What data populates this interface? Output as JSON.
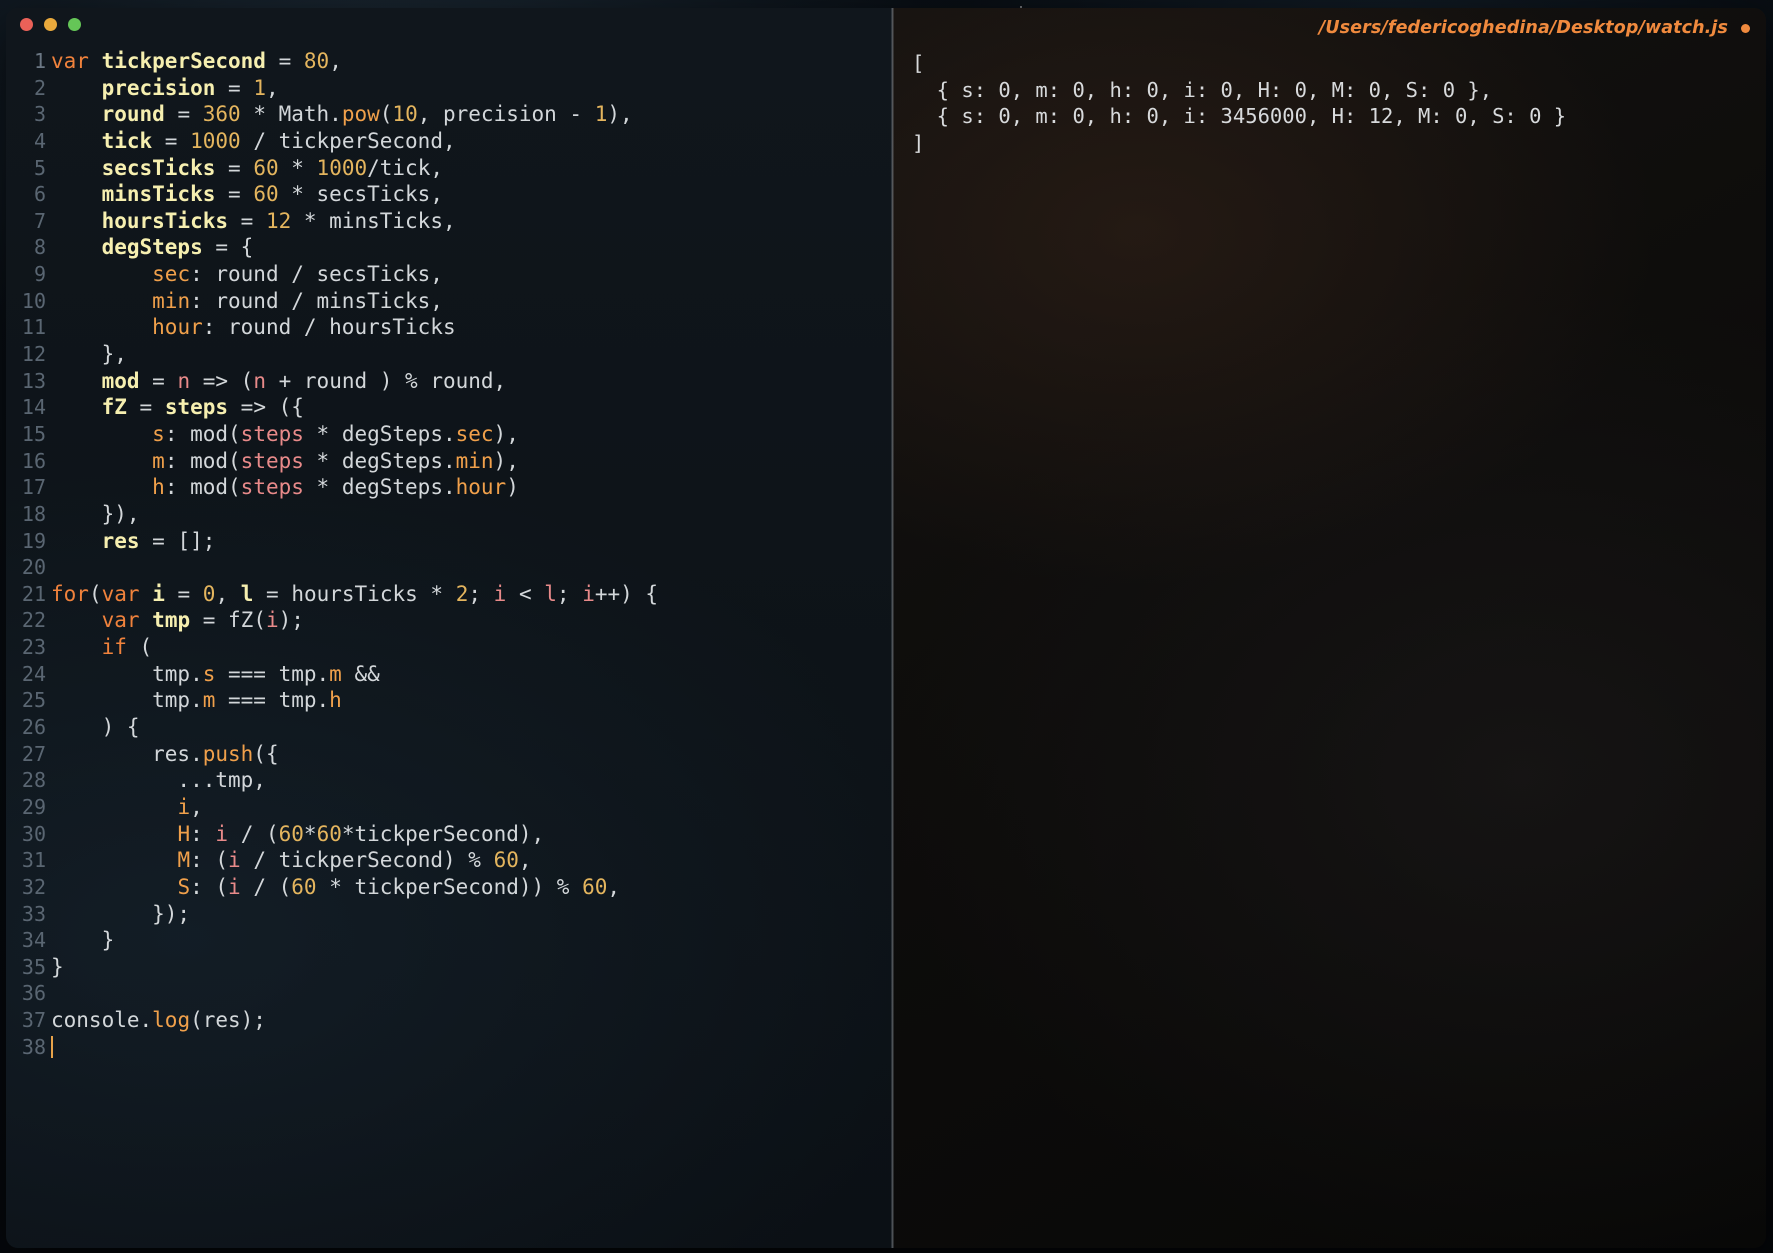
{
  "window": {
    "traffic_lights": [
      {
        "name": "close",
        "color": "#ea6158"
      },
      {
        "name": "minimize",
        "color": "#e9a93c"
      },
      {
        "name": "zoom",
        "color": "#65c657"
      }
    ],
    "title": "/Users/federicoghedina/Desktop/watch.js",
    "modified_indicator": "●",
    "accent_color": "#f08a3e"
  },
  "editor": {
    "language": "javascript",
    "cursor_line": 38,
    "lines": [
      {
        "n": "1",
        "tokens": [
          [
            "kw",
            "var"
          ],
          [
            "plain",
            " "
          ],
          [
            "def",
            "tickperSecond"
          ],
          [
            "plain",
            " = "
          ],
          [
            "num",
            "80"
          ],
          [
            "plain",
            ","
          ]
        ]
      },
      {
        "n": "2",
        "tokens": [
          [
            "plain",
            "    "
          ],
          [
            "def",
            "precision"
          ],
          [
            "plain",
            " = "
          ],
          [
            "num",
            "1"
          ],
          [
            "plain",
            ","
          ]
        ]
      },
      {
        "n": "3",
        "tokens": [
          [
            "plain",
            "    "
          ],
          [
            "def",
            "round"
          ],
          [
            "plain",
            " = "
          ],
          [
            "num",
            "360"
          ],
          [
            "plain",
            " * Math."
          ],
          [
            "fn",
            "pow"
          ],
          [
            "plain",
            "("
          ],
          [
            "num",
            "10"
          ],
          [
            "plain",
            ", precision - "
          ],
          [
            "num",
            "1"
          ],
          [
            "plain",
            "),"
          ]
        ]
      },
      {
        "n": "4",
        "tokens": [
          [
            "plain",
            "    "
          ],
          [
            "def",
            "tick"
          ],
          [
            "plain",
            " = "
          ],
          [
            "num",
            "1000"
          ],
          [
            "plain",
            " / tickperSecond,"
          ]
        ]
      },
      {
        "n": "5",
        "tokens": [
          [
            "plain",
            "    "
          ],
          [
            "def",
            "secsTicks"
          ],
          [
            "plain",
            " = "
          ],
          [
            "num",
            "60"
          ],
          [
            "plain",
            " * "
          ],
          [
            "num",
            "1000"
          ],
          [
            "plain",
            "/tick,"
          ]
        ]
      },
      {
        "n": "6",
        "tokens": [
          [
            "plain",
            "    "
          ],
          [
            "def",
            "minsTicks"
          ],
          [
            "plain",
            " = "
          ],
          [
            "num",
            "60"
          ],
          [
            "plain",
            " * secsTicks,"
          ]
        ]
      },
      {
        "n": "7",
        "tokens": [
          [
            "plain",
            "    "
          ],
          [
            "def",
            "hoursTicks"
          ],
          [
            "plain",
            " = "
          ],
          [
            "num",
            "12"
          ],
          [
            "plain",
            " * minsTicks,"
          ]
        ]
      },
      {
        "n": "8",
        "tokens": [
          [
            "plain",
            "    "
          ],
          [
            "def",
            "degSteps"
          ],
          [
            "plain",
            " = {"
          ]
        ]
      },
      {
        "n": "9",
        "tokens": [
          [
            "plain",
            "        "
          ],
          [
            "key",
            "sec"
          ],
          [
            "plain",
            ": round / secsTicks,"
          ]
        ]
      },
      {
        "n": "10",
        "tokens": [
          [
            "plain",
            "        "
          ],
          [
            "key",
            "min"
          ],
          [
            "plain",
            ": round / minsTicks,"
          ]
        ]
      },
      {
        "n": "11",
        "tokens": [
          [
            "plain",
            "        "
          ],
          [
            "key",
            "hour"
          ],
          [
            "plain",
            ": round / hoursTicks"
          ]
        ]
      },
      {
        "n": "12",
        "tokens": [
          [
            "plain",
            "    },"
          ]
        ]
      },
      {
        "n": "13",
        "tokens": [
          [
            "plain",
            "    "
          ],
          [
            "def",
            "mod"
          ],
          [
            "plain",
            " = "
          ],
          [
            "prm",
            "n"
          ],
          [
            "plain",
            " => ("
          ],
          [
            "prm",
            "n"
          ],
          [
            "plain",
            " + round ) % round,"
          ]
        ]
      },
      {
        "n": "14",
        "tokens": [
          [
            "plain",
            "    "
          ],
          [
            "def",
            "fZ"
          ],
          [
            "plain",
            " = "
          ],
          [
            "def",
            "steps"
          ],
          [
            "plain",
            " => ({"
          ]
        ]
      },
      {
        "n": "15",
        "tokens": [
          [
            "plain",
            "        "
          ],
          [
            "key",
            "s"
          ],
          [
            "plain",
            ": mod("
          ],
          [
            "prm",
            "steps"
          ],
          [
            "plain",
            " * degSteps."
          ],
          [
            "key",
            "sec"
          ],
          [
            "plain",
            "),"
          ]
        ]
      },
      {
        "n": "16",
        "tokens": [
          [
            "plain",
            "        "
          ],
          [
            "key",
            "m"
          ],
          [
            "plain",
            ": mod("
          ],
          [
            "prm",
            "steps"
          ],
          [
            "plain",
            " * degSteps."
          ],
          [
            "key",
            "min"
          ],
          [
            "plain",
            "),"
          ]
        ]
      },
      {
        "n": "17",
        "tokens": [
          [
            "plain",
            "        "
          ],
          [
            "key",
            "h"
          ],
          [
            "plain",
            ": mod("
          ],
          [
            "prm",
            "steps"
          ],
          [
            "plain",
            " * degSteps."
          ],
          [
            "key",
            "hour"
          ],
          [
            "plain",
            ")"
          ]
        ]
      },
      {
        "n": "18",
        "tokens": [
          [
            "plain",
            "    }),"
          ]
        ]
      },
      {
        "n": "19",
        "tokens": [
          [
            "plain",
            "    "
          ],
          [
            "def",
            "res"
          ],
          [
            "plain",
            " = [];"
          ]
        ]
      },
      {
        "n": "20",
        "tokens": []
      },
      {
        "n": "21",
        "tokens": [
          [
            "kw",
            "for"
          ],
          [
            "plain",
            "("
          ],
          [
            "kw",
            "var"
          ],
          [
            "plain",
            " "
          ],
          [
            "def",
            "i"
          ],
          [
            "plain",
            " = "
          ],
          [
            "num",
            "0"
          ],
          [
            "plain",
            ", "
          ],
          [
            "def",
            "l"
          ],
          [
            "plain",
            " = hoursTicks * "
          ],
          [
            "num",
            "2"
          ],
          [
            "plain",
            "; "
          ],
          [
            "prm",
            "i"
          ],
          [
            "plain",
            " < "
          ],
          [
            "prm",
            "l"
          ],
          [
            "plain",
            "; "
          ],
          [
            "prm",
            "i"
          ],
          [
            "plain",
            "++) {"
          ]
        ]
      },
      {
        "n": "22",
        "tokens": [
          [
            "plain",
            "    "
          ],
          [
            "kw",
            "var"
          ],
          [
            "plain",
            " "
          ],
          [
            "def",
            "tmp"
          ],
          [
            "plain",
            " = fZ("
          ],
          [
            "prm",
            "i"
          ],
          [
            "plain",
            ");"
          ]
        ]
      },
      {
        "n": "23",
        "tokens": [
          [
            "plain",
            "    "
          ],
          [
            "kw",
            "if"
          ],
          [
            "plain",
            " ("
          ]
        ]
      },
      {
        "n": "24",
        "tokens": [
          [
            "plain",
            "        tmp."
          ],
          [
            "key",
            "s"
          ],
          [
            "plain",
            " === tmp."
          ],
          [
            "key",
            "m"
          ],
          [
            "plain",
            " &&"
          ]
        ]
      },
      {
        "n": "25",
        "tokens": [
          [
            "plain",
            "        tmp."
          ],
          [
            "key",
            "m"
          ],
          [
            "plain",
            " === tmp."
          ],
          [
            "key",
            "h"
          ]
        ]
      },
      {
        "n": "26",
        "tokens": [
          [
            "plain",
            "    ) {"
          ]
        ]
      },
      {
        "n": "27",
        "tokens": [
          [
            "plain",
            "        res."
          ],
          [
            "fn",
            "push"
          ],
          [
            "plain",
            "({"
          ]
        ]
      },
      {
        "n": "28",
        "tokens": [
          [
            "plain",
            "          ...tmp,"
          ]
        ]
      },
      {
        "n": "29",
        "tokens": [
          [
            "plain",
            "          "
          ],
          [
            "key",
            "i"
          ],
          [
            "plain",
            ","
          ]
        ]
      },
      {
        "n": "30",
        "tokens": [
          [
            "plain",
            "          "
          ],
          [
            "key",
            "H"
          ],
          [
            "plain",
            ": "
          ],
          [
            "prm",
            "i"
          ],
          [
            "plain",
            " / ("
          ],
          [
            "num",
            "60"
          ],
          [
            "plain",
            "*"
          ],
          [
            "num",
            "60"
          ],
          [
            "plain",
            "*tickperSecond),"
          ]
        ]
      },
      {
        "n": "31",
        "tokens": [
          [
            "plain",
            "          "
          ],
          [
            "key",
            "M"
          ],
          [
            "plain",
            ": ("
          ],
          [
            "prm",
            "i"
          ],
          [
            "plain",
            " / tickperSecond) % "
          ],
          [
            "num",
            "60"
          ],
          [
            "plain",
            ","
          ]
        ]
      },
      {
        "n": "32",
        "tokens": [
          [
            "plain",
            "          "
          ],
          [
            "key",
            "S"
          ],
          [
            "plain",
            ": ("
          ],
          [
            "prm",
            "i"
          ],
          [
            "plain",
            " / ("
          ],
          [
            "num",
            "60"
          ],
          [
            "plain",
            " * tickperSecond)) % "
          ],
          [
            "num",
            "60"
          ],
          [
            "plain",
            ","
          ]
        ]
      },
      {
        "n": "33",
        "tokens": [
          [
            "plain",
            "        });"
          ]
        ]
      },
      {
        "n": "34",
        "tokens": [
          [
            "plain",
            "    }"
          ]
        ]
      },
      {
        "n": "35",
        "tokens": [
          [
            "plain",
            "}"
          ]
        ]
      },
      {
        "n": "36",
        "tokens": []
      },
      {
        "n": "37",
        "tokens": [
          [
            "plain",
            "console."
          ],
          [
            "fn",
            "log"
          ],
          [
            "plain",
            "(res);"
          ]
        ]
      },
      {
        "n": "38",
        "tokens": [],
        "caret": true
      }
    ]
  },
  "console": {
    "lines": [
      "[",
      "  { s: 0, m: 0, h: 0, i: 0, H: 0, M: 0, S: 0 },",
      "  { s: 0, m: 0, h: 0, i: 3456000, H: 12, M: 0, S: 0 }",
      "]"
    ]
  }
}
